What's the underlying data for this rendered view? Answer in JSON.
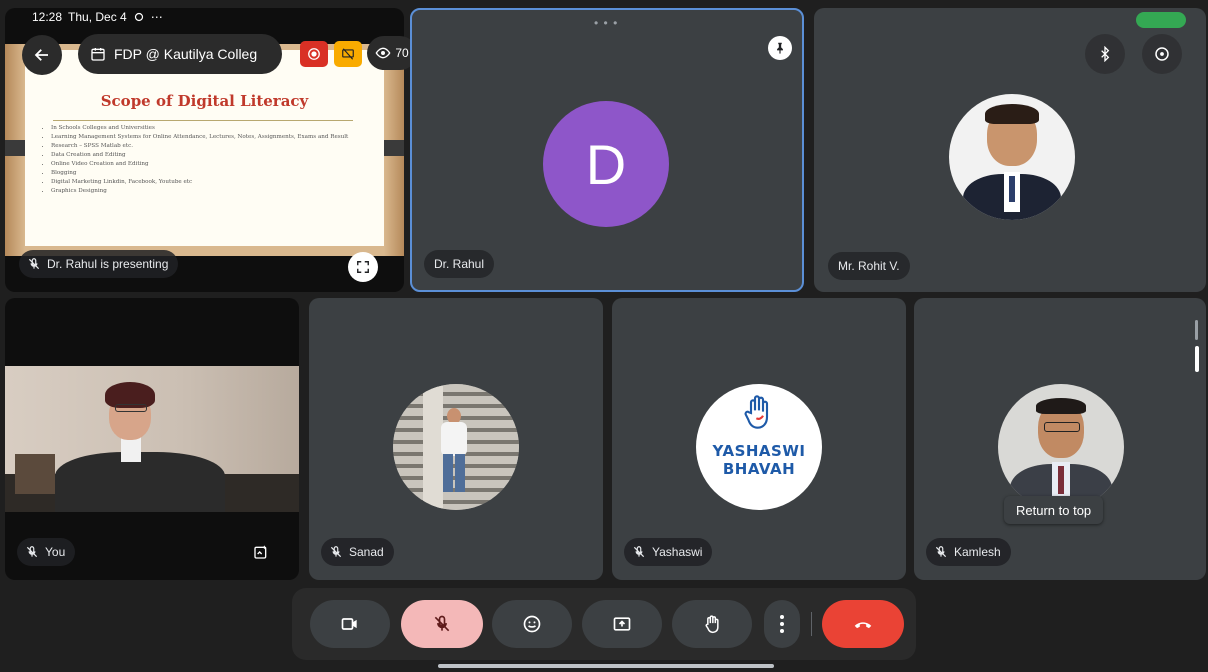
{
  "status_bar": {
    "time": "12:28",
    "date": "Thu, Dec 4",
    "more": "⋯"
  },
  "meeting": {
    "title": "FDP @ Kautilya Colleg",
    "viewers": "70"
  },
  "slide": {
    "title": "Scope of Digital Literacy",
    "bullets": [
      "In Schools Colleges and Universities",
      "Learning Management Systems for Online Attendance, Lectures, Notes, Assignments, Exams and Result",
      "Research – SPSS Matlab etc.",
      "Data Creation and Editing",
      "Online Video Creation and Editing",
      "Blogging",
      "Digital Marketing Linkdin, Facebook, Youtube etc",
      "Graphics Designing"
    ]
  },
  "tiles": {
    "presenter": {
      "label": "Dr. Rahul is presenting"
    },
    "rahul": {
      "label": "Dr. Rahul",
      "initial": "D"
    },
    "rohit": {
      "label": "Mr. Rohit V."
    },
    "you": {
      "label": "You"
    },
    "sanad": {
      "label": "Sanad"
    },
    "yashaswi": {
      "label": "Yashaswi",
      "logo_line1": "YASHASWI",
      "logo_line2": "BHAVAH"
    },
    "kamlesh": {
      "label": "Kamlesh"
    }
  },
  "tooltip": {
    "return_to_top": "Return to top"
  },
  "colors": {
    "background": "#1f1f1f",
    "tile": "#3c4043",
    "avatar_purple": "#8e56c9",
    "mic_active_bg": "#f4b8b8",
    "end_call_red": "#ea4335",
    "logo_blue": "#1e5aa8"
  },
  "icons": {
    "back": "arrow-left-icon",
    "calendar": "calendar-icon",
    "record": "record-icon",
    "no_screenshare": "no-screenshare-icon",
    "viewers": "eye-icon",
    "pin": "pin-icon",
    "bluetooth": "bluetooth-icon",
    "switch_camera": "switch-camera-icon",
    "camera": "video-camera-icon",
    "mic": "mic-off-icon",
    "emoji": "emoji-icon",
    "present": "present-screen-icon",
    "hand": "raise-hand-icon",
    "more": "more-vertical-icon",
    "end_call": "end-call-icon"
  }
}
